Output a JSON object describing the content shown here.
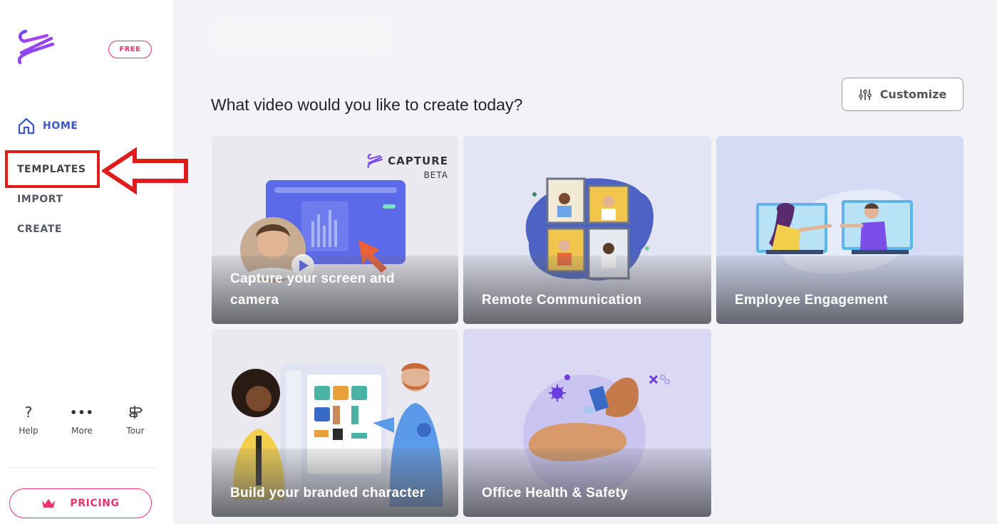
{
  "sidebar": {
    "badge": "FREE",
    "nav": {
      "home": "HOME",
      "templates": "TEMPLATES",
      "import": "IMPORT",
      "create": "CREATE"
    },
    "tools": {
      "help": "Help",
      "more": "More",
      "tour": "Tour"
    },
    "pricing": "PRICING"
  },
  "main": {
    "heading": "What video would you like to create today?",
    "customize": "Customize",
    "cards": [
      {
        "title": "Capture your screen and camera",
        "tag": "CAPTURE",
        "tag_sub": "BETA"
      },
      {
        "title": "Remote Communication"
      },
      {
        "title": "Employee Engagement"
      },
      {
        "title": "Build your branded character"
      },
      {
        "title": "Office Health & Safety"
      }
    ]
  },
  "colors": {
    "accent": "#e8336b",
    "home_active": "#3956c9",
    "annotation_red": "#e01b1b"
  },
  "icons": [
    "brand-logo-icon",
    "home-icon",
    "help-icon",
    "more-icon",
    "tour-icon",
    "crown-icon",
    "sliders-icon",
    "capture-logo-icon",
    "red-arrow-annotation"
  ]
}
